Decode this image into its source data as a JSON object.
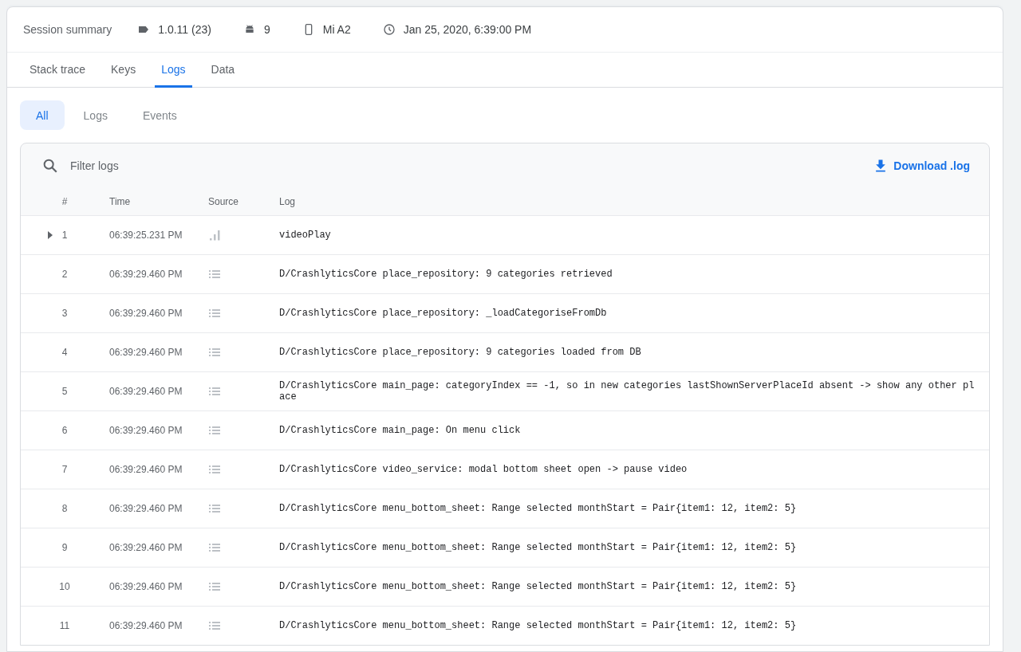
{
  "summary": {
    "title": "Session summary",
    "version": "1.0.11 (23)",
    "os": "9",
    "device": "Mi A2",
    "date": "Jan 25, 2020, 6:39:00 PM"
  },
  "tabs": [
    {
      "label": "Stack trace",
      "selected": false
    },
    {
      "label": "Keys",
      "selected": false
    },
    {
      "label": "Logs",
      "selected": true
    },
    {
      "label": "Data",
      "selected": false
    }
  ],
  "filters": [
    {
      "label": "All",
      "selected": true
    },
    {
      "label": "Logs",
      "selected": false
    },
    {
      "label": "Events",
      "selected": false
    }
  ],
  "search": {
    "placeholder": "Filter logs"
  },
  "download": "Download .log",
  "table": {
    "columns": [
      "#",
      "Time",
      "Source",
      "Log"
    ],
    "rows": [
      {
        "n": "1",
        "time": "06:39:25.231 PM",
        "kind": "event",
        "expandable": true,
        "log": "videoPlay"
      },
      {
        "n": "2",
        "time": "06:39:29.460 PM",
        "kind": "log",
        "expandable": false,
        "log": "D/CrashlyticsCore place_repository: 9 categories retrieved"
      },
      {
        "n": "3",
        "time": "06:39:29.460 PM",
        "kind": "log",
        "expandable": false,
        "log": "D/CrashlyticsCore place_repository: _loadCategoriseFromDb"
      },
      {
        "n": "4",
        "time": "06:39:29.460 PM",
        "kind": "log",
        "expandable": false,
        "log": "D/CrashlyticsCore place_repository: 9 categories loaded from DB"
      },
      {
        "n": "5",
        "time": "06:39:29.460 PM",
        "kind": "log",
        "expandable": false,
        "log": "D/CrashlyticsCore main_page: categoryIndex == -1, so in new categories lastShownServerPlaceId absent -> show any other place"
      },
      {
        "n": "6",
        "time": "06:39:29.460 PM",
        "kind": "log",
        "expandable": false,
        "log": "D/CrashlyticsCore main_page: On menu click"
      },
      {
        "n": "7",
        "time": "06:39:29.460 PM",
        "kind": "log",
        "expandable": false,
        "log": "D/CrashlyticsCore video_service: modal bottom sheet open -> pause video"
      },
      {
        "n": "8",
        "time": "06:39:29.460 PM",
        "kind": "log",
        "expandable": false,
        "log": "D/CrashlyticsCore menu_bottom_sheet: Range selected monthStart = Pair{item1: 12, item2: 5}"
      },
      {
        "n": "9",
        "time": "06:39:29.460 PM",
        "kind": "log",
        "expandable": false,
        "log": "D/CrashlyticsCore menu_bottom_sheet: Range selected monthStart = Pair{item1: 12, item2: 5}"
      },
      {
        "n": "10",
        "time": "06:39:29.460 PM",
        "kind": "log",
        "expandable": false,
        "log": "D/CrashlyticsCore menu_bottom_sheet: Range selected monthStart = Pair{item1: 12, item2: 5}"
      },
      {
        "n": "11",
        "time": "06:39:29.460 PM",
        "kind": "log",
        "expandable": false,
        "log": "D/CrashlyticsCore menu_bottom_sheet: Range selected monthStart = Pair{item1: 12, item2: 5}"
      }
    ]
  }
}
